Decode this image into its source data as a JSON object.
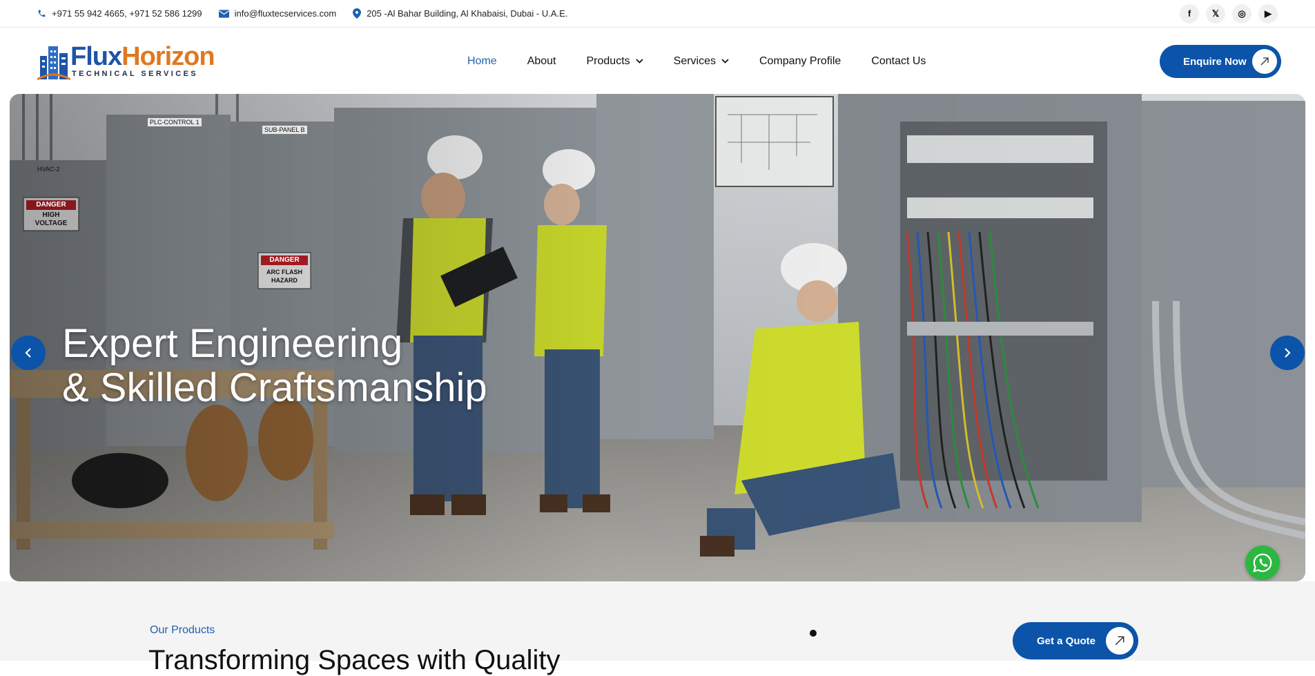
{
  "topbar": {
    "phones": "+971 55 942 4665, +971 52 586 1299",
    "email": "info@fluxtecservices.com",
    "address": "205 -Al Bahar Building, Al Khabaisi, Dubai - U.A.E.",
    "socials": [
      {
        "icon": "facebook-icon",
        "glyph": "f"
      },
      {
        "icon": "x-twitter-icon",
        "glyph": "𝕏"
      },
      {
        "icon": "instagram-icon",
        "glyph": "◎"
      },
      {
        "icon": "youtube-icon",
        "glyph": "▶"
      }
    ]
  },
  "logo": {
    "word_part1": "Flux",
    "word_part2": "Horizon",
    "subtitle": "TECHNICAL SERVICES"
  },
  "nav": {
    "items": [
      {
        "label": "Home",
        "active": true,
        "dropdown": false
      },
      {
        "label": "About",
        "active": false,
        "dropdown": false
      },
      {
        "label": "Products",
        "active": false,
        "dropdown": true
      },
      {
        "label": "Services",
        "active": false,
        "dropdown": true
      },
      {
        "label": "Company Profile",
        "active": false,
        "dropdown": false
      },
      {
        "label": "Contact Us",
        "active": false,
        "dropdown": false
      }
    ],
    "cta_label": "Enquire Now"
  },
  "hero": {
    "title_line1": "Expert Engineering",
    "title_line2": "& Skilled Craftsmanship",
    "sign_danger_1": "DANGER",
    "sign_high_voltage": "HIGH VOLTAGE",
    "sign_danger_2": "DANGER",
    "sign_arc_flash": "ARC FLASH HAZARD",
    "sign_hvac": "HVAC-2",
    "sign_plc": "PLC-CONTROL 1",
    "sign_subpanel": "SUB-PANEL B"
  },
  "products": {
    "label": "Our Products",
    "heading": "Transforming Spaces with Quality",
    "cta_label": "Get a Quote"
  },
  "colors": {
    "primary": "#0b54a9",
    "accent_orange": "#e07820",
    "whatsapp": "#2bb741"
  }
}
